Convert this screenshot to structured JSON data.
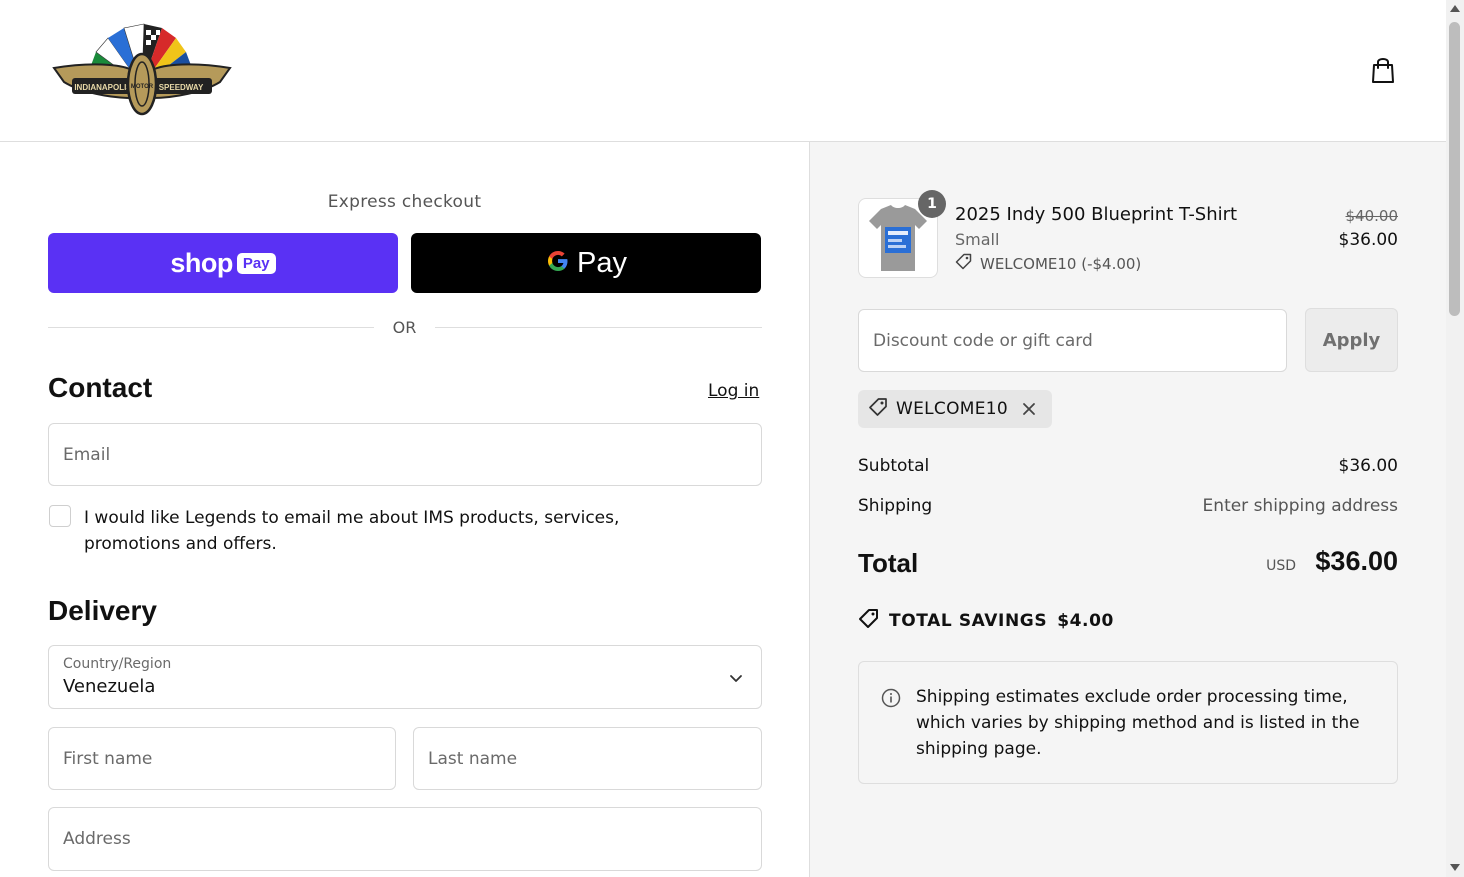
{
  "header": {
    "logo_alt": "Indianapolis Motor Speedway",
    "logo_text_left": "INDIANAPOLIS",
    "logo_text_right": "SPEEDWAY",
    "logo_text_center": "MOTOR",
    "cart_icon": "shopping-bag-icon"
  },
  "express": {
    "label": "Express checkout",
    "shop_pay": {
      "word": "shop",
      "pill": "Pay",
      "color": "#5a31f4"
    },
    "google_pay": {
      "word": "Pay",
      "color": "#000000"
    },
    "separator": "OR"
  },
  "contact": {
    "title": "Contact",
    "login_label": "Log in",
    "email_placeholder": "Email",
    "marketing_opt_in": "I would like Legends to email me about IMS products, services, promotions and offers.",
    "marketing_checked": false
  },
  "delivery": {
    "title": "Delivery",
    "country_label": "Country/Region",
    "country_value": "Venezuela",
    "first_name_placeholder": "First name",
    "last_name_placeholder": "Last name",
    "address_placeholder": "Address"
  },
  "order": {
    "item": {
      "quantity": "1",
      "name": "2025 Indy 500 Blueprint T-Shirt",
      "variant": "Small",
      "discount_line": "WELCOME10 (-$4.00)",
      "original_price": "$40.00",
      "price": "$36.00"
    },
    "discount_placeholder": "Discount code or gift card",
    "apply_label": "Apply",
    "applied_code": "WELCOME10",
    "subtotal_label": "Subtotal",
    "subtotal_value": "$36.00",
    "shipping_label": "Shipping",
    "shipping_value": "Enter shipping address",
    "total_label": "Total",
    "total_currency": "USD",
    "total_value": "$36.00",
    "savings_label": "TOTAL SAVINGS",
    "savings_value": "$4.00",
    "notice": "Shipping estimates exclude order processing time, which varies by shipping method and is listed in the shipping page."
  }
}
